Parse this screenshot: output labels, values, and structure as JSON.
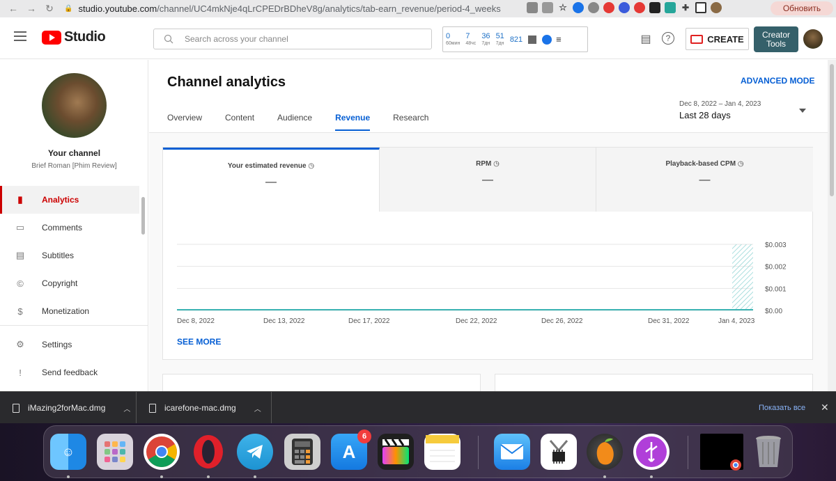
{
  "browser": {
    "url_host": "studio.youtube.com",
    "url_path": "/channel/UC4mkNje4qLrCPEDrBDheV8g/analytics/tab-earn_revenue/period-4_weeks",
    "update_label": "Обновить"
  },
  "header": {
    "logo_text": "Studio",
    "search_placeholder": "Search across your channel",
    "stats": [
      {
        "value": "0",
        "label": "60мин"
      },
      {
        "value": "7",
        "label": "48чс"
      },
      {
        "value": "36",
        "label": "7дн"
      },
      {
        "value": "51",
        "label": "7дн"
      },
      {
        "value": "821",
        "label": ""
      }
    ],
    "create_label": "CREATE",
    "creator_tools_label": "Creator Tools"
  },
  "sidebar": {
    "your_channel": "Your channel",
    "channel_name": "Brief Roman [Phim Review]",
    "items": [
      {
        "label": "Analytics",
        "icon": "analytics-icon"
      },
      {
        "label": "Comments",
        "icon": "comments-icon"
      },
      {
        "label": "Subtitles",
        "icon": "subtitles-icon"
      },
      {
        "label": "Copyright",
        "icon": "copyright-icon"
      },
      {
        "label": "Monetization",
        "icon": "monetization-icon"
      },
      {
        "label": "Settings",
        "icon": "settings-icon"
      },
      {
        "label": "Send feedback",
        "icon": "feedback-icon"
      }
    ]
  },
  "main": {
    "title": "Channel analytics",
    "advanced_mode": "ADVANCED MODE",
    "tabs": [
      {
        "label": "Overview"
      },
      {
        "label": "Content"
      },
      {
        "label": "Audience"
      },
      {
        "label": "Revenue"
      },
      {
        "label": "Research"
      }
    ],
    "date_range_small": "Dec 8, 2022 – Jan 4, 2023",
    "date_range_big": "Last 28 days",
    "metrics": [
      {
        "label": "Your estimated revenue",
        "value": "—"
      },
      {
        "label": "RPM",
        "value": "—"
      },
      {
        "label": "Playback-based CPM",
        "value": "—"
      }
    ],
    "see_more": "SEE MORE"
  },
  "chart_data": {
    "type": "line",
    "x_tick_labels": [
      "Dec 8, 2022",
      "Dec 13, 2022",
      "Dec 17, 2022",
      "Dec 22, 2022",
      "Dec 26, 2022",
      "Dec 31, 2022",
      "Jan 4, 2023"
    ],
    "y_tick_labels": [
      "$0.003",
      "$0.002",
      "$0.001",
      "$0.00"
    ],
    "ylim": [
      0,
      0.003
    ],
    "series": [
      {
        "values": [
          0,
          0,
          0,
          0,
          0,
          0,
          0
        ]
      }
    ],
    "grid": true,
    "colors": {
      "line": "#3bb3b3",
      "hatch": "#8fd4d4"
    }
  },
  "downloads": {
    "files": [
      {
        "name": "iMazing2forMac.dmg"
      },
      {
        "name": "icarefone-mac.dmg"
      }
    ],
    "show_all": "Показать все"
  },
  "dock": {
    "appstore_badge": "6"
  }
}
